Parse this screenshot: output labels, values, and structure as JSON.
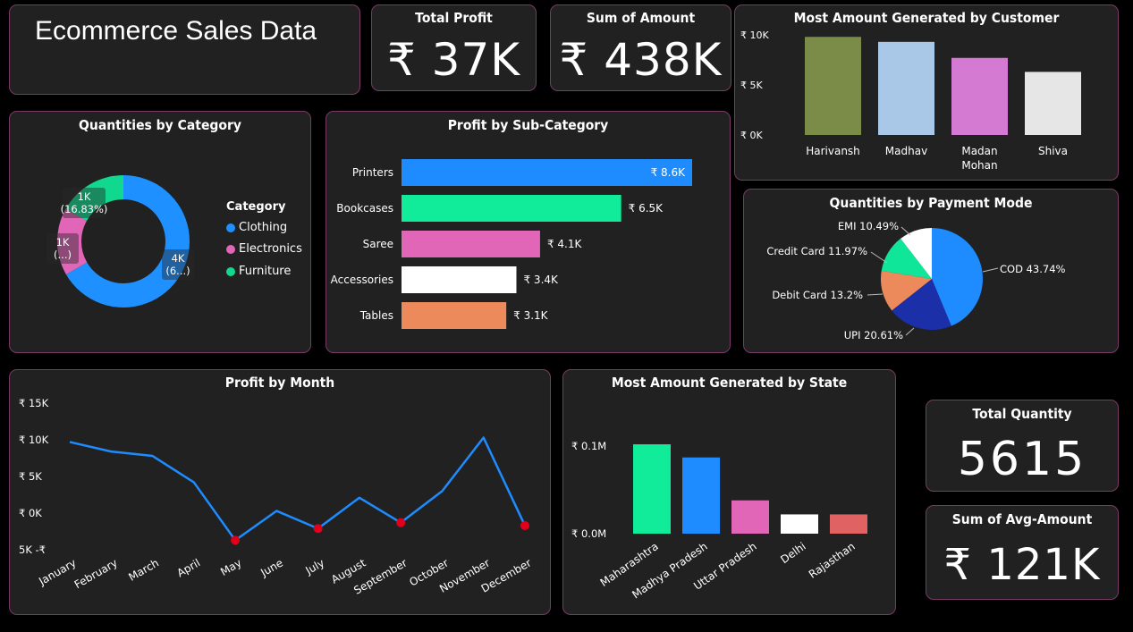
{
  "header": {
    "title": "Ecommerce Sales Data"
  },
  "kpis": {
    "total_profit": {
      "label": "Total Profit",
      "value": "₹ 37K"
    },
    "sum_amount": {
      "label": "Sum of Amount",
      "value": "₹ 438K"
    },
    "total_quantity": {
      "label": "Total Quantity",
      "value": "5615"
    },
    "avg_amount": {
      "label": "Sum of Avg-Amount",
      "value": "₹ 121K"
    }
  },
  "chart_data": [
    {
      "id": "customer",
      "type": "bar",
      "title": "Most Amount Generated by Customer",
      "categories": [
        "Harivansh",
        "Madhav",
        "Madan Mohan",
        "Shiva"
      ],
      "category_lines": [
        [
          "Harivansh"
        ],
        [
          "Madhav"
        ],
        [
          "Madan",
          "Mohan"
        ],
        [
          "Shiva"
        ]
      ],
      "values": [
        9800,
        9300,
        7700,
        6300
      ],
      "colors": [
        "#7b8c48",
        "#a9c8e8",
        "#d47ad2",
        "#e6e6e6"
      ],
      "yticks": [
        "₹ 10K",
        "₹ 5K",
        "₹ 0K"
      ],
      "ylim": [
        0,
        10000
      ]
    },
    {
      "id": "category",
      "type": "pie",
      "title": "Quantities by Category",
      "legend_title": "Category",
      "categories": [
        "Clothing",
        "Electronics",
        "Furniture"
      ],
      "values": [
        0.6668,
        0.1649,
        0.1683
      ],
      "colors": [
        "#1e90ff",
        "#e266b8",
        "#10d98f"
      ],
      "slice_labels": [
        [
          "4K",
          "(6...)"
        ],
        [
          "1K",
          "(...)"
        ],
        [
          "1K",
          "(16.83%)"
        ]
      ]
    },
    {
      "id": "subcategory",
      "type": "bar",
      "title": "Profit by Sub-Category",
      "categories": [
        "Printers",
        "Bookcases",
        "Saree",
        "Accessories",
        "Tables"
      ],
      "values": [
        8600,
        6500,
        4100,
        3400,
        3100
      ],
      "labels": [
        "₹ 8.6K",
        "₹ 6.5K",
        "₹ 4.1K",
        "₹ 3.4K",
        "₹ 3.1K"
      ],
      "colors": [
        "#1e8cff",
        "#10ec9a",
        "#e266b8",
        "#ffffff",
        "#ec8a5c"
      ]
    },
    {
      "id": "payment",
      "type": "pie",
      "title": "Quantities by Payment Mode",
      "categories": [
        "COD",
        "UPI",
        "Debit Card",
        "Credit Card",
        "EMI"
      ],
      "values": [
        43.74,
        20.61,
        13.2,
        11.97,
        10.49
      ],
      "labels": [
        "COD 43.74%",
        "UPI 20.61%",
        "Debit Card 13.2%",
        "Credit Card 11.97%",
        "EMI 10.49%"
      ],
      "colors": [
        "#1e8cff",
        "#1a2fa8",
        "#ec8a5c",
        "#10e69a",
        "#ffffff"
      ]
    },
    {
      "id": "month",
      "type": "line",
      "title": "Profit by Month",
      "categories": [
        "January",
        "February",
        "March",
        "April",
        "May",
        "June",
        "July",
        "August",
        "September",
        "October",
        "November",
        "December"
      ],
      "values": [
        9700,
        8400,
        7800,
        4200,
        -3700,
        300,
        -2100,
        2100,
        -1300,
        3000,
        10300,
        -1700
      ],
      "negative_markers": [
        4,
        6,
        8,
        11
      ],
      "yticks": [
        "₹ 15K",
        "₹ 10K",
        "₹ 5K",
        "₹ 0K",
        "5K -₹"
      ],
      "ylim": [
        -5000,
        15000
      ],
      "line_color": "#1e8cff",
      "marker_color": "#e0001c"
    },
    {
      "id": "state",
      "type": "bar",
      "title": "Most Amount Generated by State",
      "categories": [
        "Maharashtra",
        "Madhya Pradesh",
        "Uttar Pradesh",
        "Delhi",
        "Rajasthan"
      ],
      "values": [
        0.102,
        0.087,
        0.038,
        0.022,
        0.022
      ],
      "colors": [
        "#10ec9a",
        "#1e8cff",
        "#e266b8",
        "#ffffff",
        "#e06262"
      ],
      "yticks": [
        "₹ 0.1M",
        "₹ 0.0M"
      ],
      "ylim": [
        0,
        0.1
      ]
    }
  ]
}
